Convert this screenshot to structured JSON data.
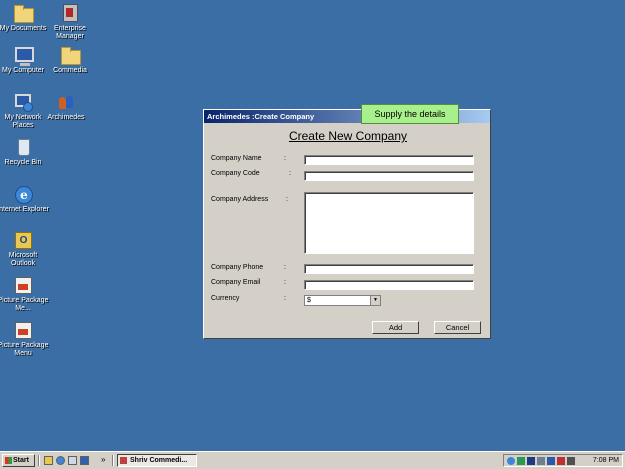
{
  "desktop_icons": [
    {
      "label": "My Documents",
      "icon": "folder-icon"
    },
    {
      "label": "Enterprise Manager",
      "icon": "enterprise-manager-icon"
    },
    {
      "label": "My Computer",
      "icon": "computer-icon"
    },
    {
      "label": "Commedia",
      "icon": "folder-icon"
    },
    {
      "label": "My Network Places",
      "icon": "network-icon"
    },
    {
      "label": "Archimedes",
      "icon": "people-icon"
    },
    {
      "label": "Recycle Bin",
      "icon": "recycle-bin-icon"
    },
    {
      "label": "Internet Explorer",
      "icon": "internet-explorer-icon"
    },
    {
      "label": "Microsoft Outlook",
      "icon": "outlook-icon"
    },
    {
      "label": "Picture Package Me...",
      "icon": "picture-package-icon"
    },
    {
      "label": "Picture Package Menu",
      "icon": "picture-package-icon"
    }
  ],
  "dialog": {
    "title": "Archimedes :Create Company",
    "tooltip": "Supply the details",
    "heading": "Create New Company",
    "colon": ":",
    "fields": {
      "company_name": {
        "label": "Company Name",
        "value": ""
      },
      "company_code": {
        "label": "Company Code",
        "value": ""
      },
      "company_address": {
        "label": "Company Address",
        "value": ""
      },
      "company_phone": {
        "label": "Company Phone",
        "value": ""
      },
      "company_email": {
        "label": "Company Email",
        "value": ""
      },
      "currency": {
        "label": "Currency",
        "value": "$"
      }
    },
    "add_label": "Add",
    "cancel_label": "Cancel"
  },
  "taskbar": {
    "start_label": "Start",
    "chevron": "»",
    "task_label": "Shriv Commedi...",
    "clock": "7:08 PM"
  },
  "colors": {
    "desktop": "#3a6ea5",
    "window_face": "#d4d0c8",
    "tooltip_bg": "#a8f08c",
    "title_gradient_start": "#0a246a"
  }
}
